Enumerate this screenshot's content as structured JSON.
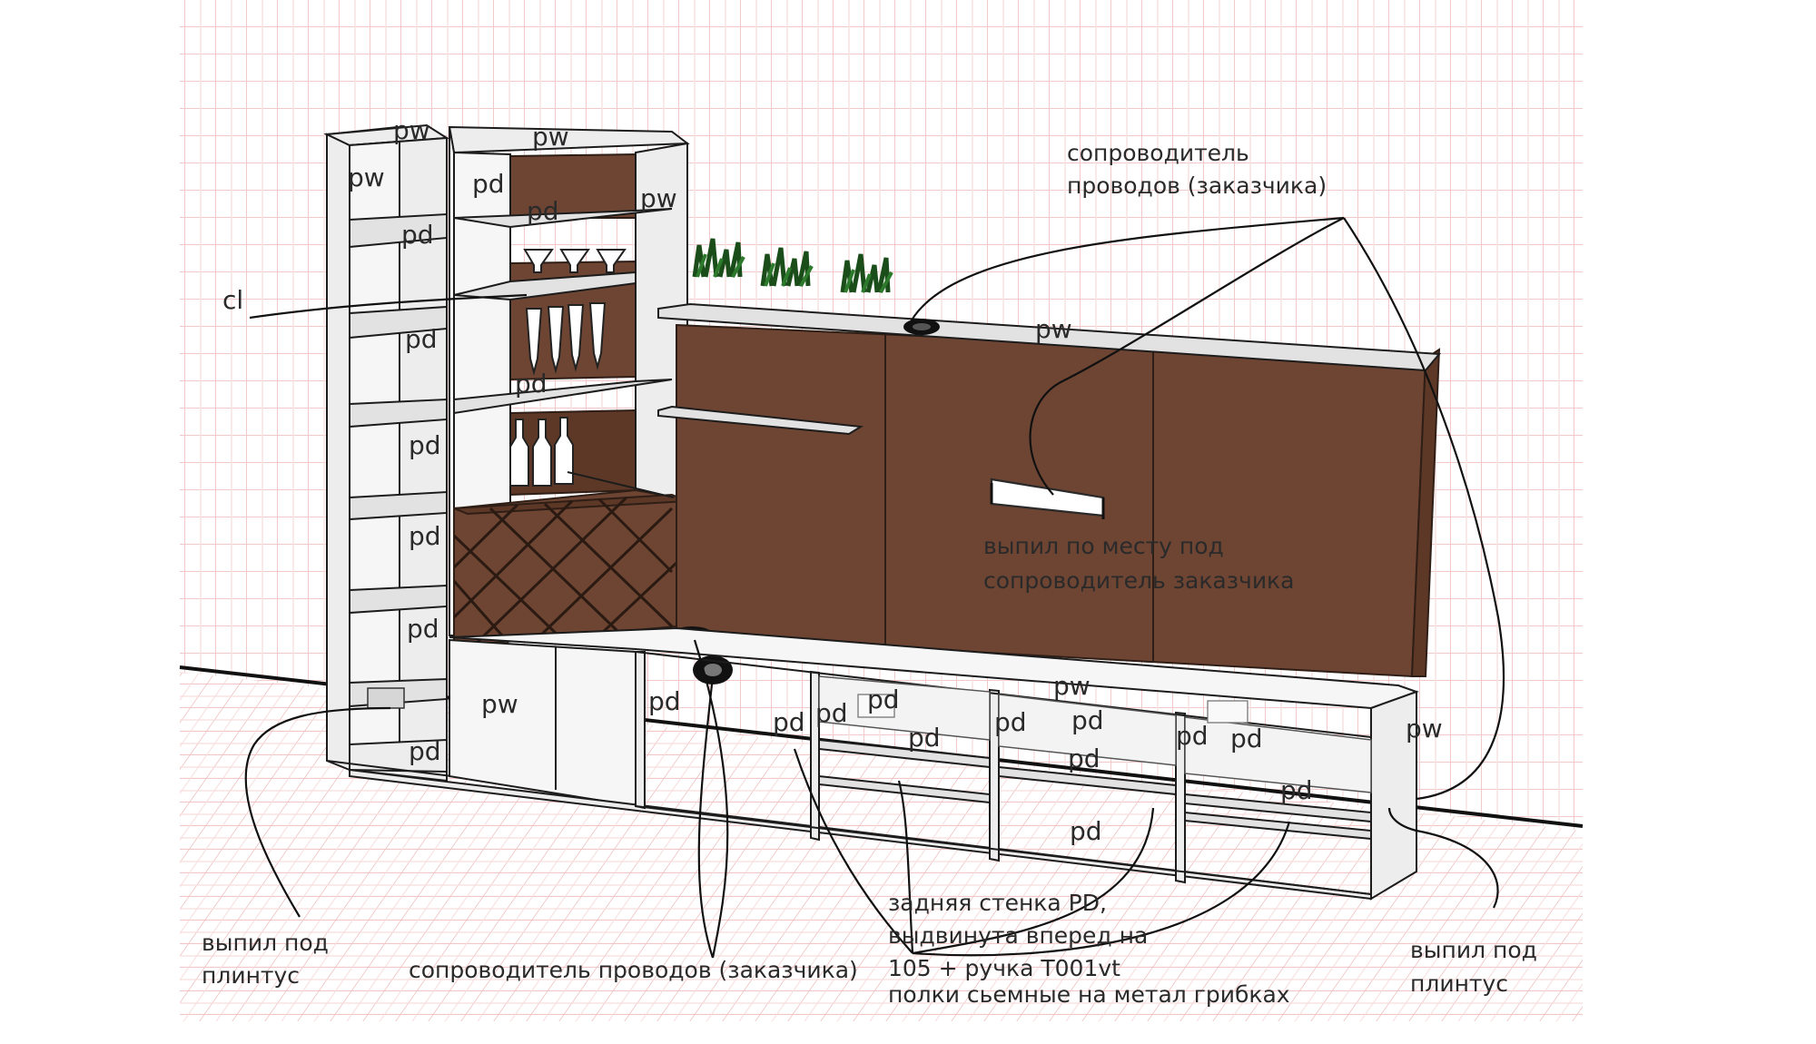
{
  "part_labels": {
    "pw": "pw",
    "pd": "pd",
    "cl": "cl"
  },
  "annotations": {
    "wire_guide_top": [
      "сопроводитель",
      "проводов (заказчика)"
    ],
    "cutout_for_guide": [
      "выпил по месту под",
      "сопроводитель заказчика"
    ],
    "baseboard_cut_left": [
      "выпил под",
      "плинтус"
    ],
    "baseboard_cut_right": [
      "выпил под",
      "плинтус"
    ],
    "wire_guide_bottom": "сопроводитель проводов (заказчика)",
    "back_wall_note": [
      "задняя стенка PD,",
      "выдвинута вперед на",
      "105 + ручка T001vt",
      "полки сьемные на метал грибках"
    ]
  },
  "colors": {
    "grid": "#f2c9c9",
    "wood": "#6e4432",
    "panel": "#ededed",
    "line": "#1c1c1c"
  },
  "icons": [
    "plant-icon",
    "wine-glass-icon",
    "bottle-icon",
    "cable-grommet-icon"
  ]
}
